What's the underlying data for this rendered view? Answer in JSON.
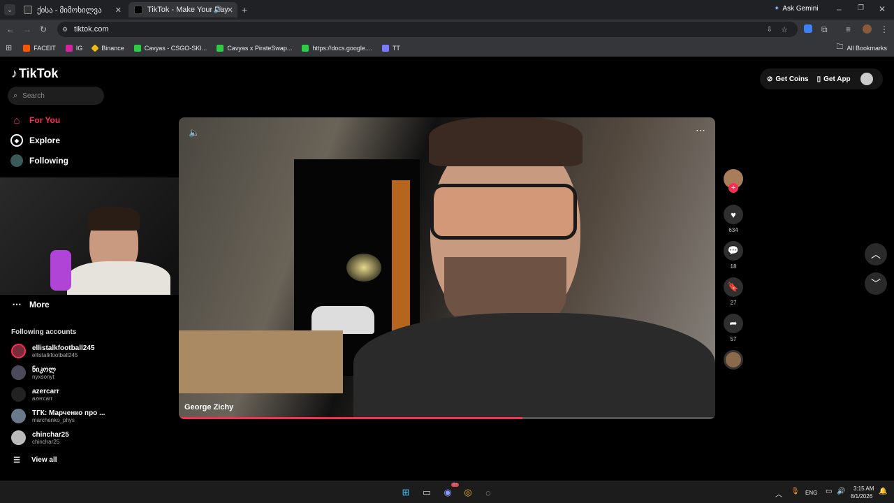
{
  "browser": {
    "tabs": [
      {
        "label": "ქისა - მიმოხილვა"
      },
      {
        "label": "TikTok - Make Your Day"
      }
    ],
    "ask_gemini": "Ask Gemini",
    "url": "tiktok.com",
    "bookmarks": [
      {
        "label": "FACEIT",
        "color": "#ff5500"
      },
      {
        "label": "IG",
        "color": "#d6249f"
      },
      {
        "label": "Binance",
        "color": "#f0b90b"
      },
      {
        "label": "Cavyas - CSGO-SKI...",
        "color": "#2ecc40"
      },
      {
        "label": "Cavyas x PirateSwap...",
        "color": "#2ecc40"
      },
      {
        "label": "https://docs.google....",
        "color": "#2ecc40"
      },
      {
        "label": "TT",
        "color": "#7a7aff"
      }
    ],
    "all_bookmarks": "All Bookmarks"
  },
  "tiktok": {
    "logo": "TikTok",
    "search_placeholder": "Search",
    "nav": {
      "for_you": "For You",
      "explore": "Explore",
      "following": "Following",
      "more": "More"
    },
    "following_accounts_title": "Following accounts",
    "accounts": [
      {
        "name": "ellistalkfootball245",
        "handle": "ellistalkfootball245",
        "color": "#7a2b3a"
      },
      {
        "name": "ნიკოლ",
        "handle": "nyxsonyt",
        "color": "#4a4a5a"
      },
      {
        "name": "azercarr",
        "handle": "azercarr",
        "color": "#222"
      },
      {
        "name": "ТГК: Марченко про ...",
        "handle": "marchenko_phys",
        "color": "#6a7a8a"
      },
      {
        "name": "chinchar25",
        "handle": "chinchar25",
        "color": "#bbb"
      }
    ],
    "view_all": "View all",
    "get_coins": "Get Coins",
    "get_app": "Get App",
    "video": {
      "author": "George Zichy",
      "progress": 0.64
    },
    "actions": {
      "likes": "634",
      "comments": "18",
      "saves": "27",
      "shares": "57"
    },
    "accent": "#fe2c55"
  },
  "taskbar": {
    "lang": "ENG",
    "time": "3:15 AM",
    "date": "8/1/2026",
    "discord_badge": "9+"
  }
}
